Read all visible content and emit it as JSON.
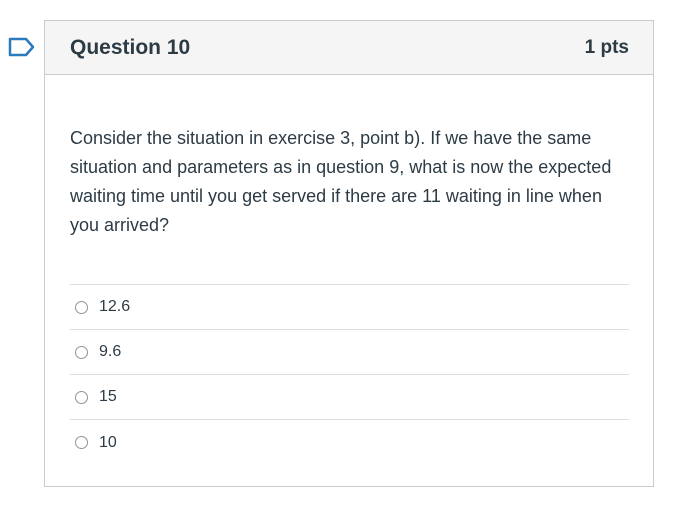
{
  "flag_icon": "bookmark-flag-icon",
  "question": {
    "title": "Question 10",
    "points": "1 pts",
    "text": "Consider the situation in exercise 3, point b). If we have the same situation and parameters as in question 9, what is now the expected waiting time until you get served if there are 11 waiting in line when you arrived?"
  },
  "answers": [
    {
      "label": "12.6"
    },
    {
      "label": "9.6"
    },
    {
      "label": "15"
    },
    {
      "label": "10"
    }
  ],
  "colors": {
    "flag": "#2b7abc",
    "header_bg": "#f5f5f5",
    "border": "#c7cdd1",
    "text": "#2d3b45"
  }
}
